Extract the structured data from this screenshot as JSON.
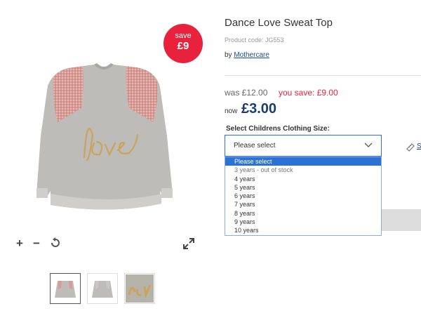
{
  "product": {
    "title": "Dance Love Sweat Top",
    "code": "Product code: JG553",
    "by_prefix": "by",
    "brand": "Mothercare"
  },
  "badge": {
    "line1": "save",
    "line2": "£9"
  },
  "prices": {
    "was": "was £12.00",
    "you_save": "you save: £9.00",
    "now_label": "now",
    "now_price": "£3.00"
  },
  "size": {
    "label": "Select Childrens Clothing Size:",
    "selected": "Please select",
    "options": [
      {
        "label": "Please select",
        "state": "selected"
      },
      {
        "label": "3 years - out of stock",
        "state": "disabled"
      },
      {
        "label": "4 years",
        "state": "normal"
      },
      {
        "label": "5 years",
        "state": "normal"
      },
      {
        "label": "6 years",
        "state": "normal"
      },
      {
        "label": "7 years",
        "state": "normal"
      },
      {
        "label": "8 years",
        "state": "normal"
      },
      {
        "label": "9 years",
        "state": "normal"
      },
      {
        "label": "10 years",
        "state": "normal"
      }
    ]
  },
  "size_guide": {
    "text": "S"
  },
  "image_tools": {
    "zoom_in": "+",
    "zoom_out": "−",
    "icons": [
      "zoom-in-icon",
      "zoom-out-icon",
      "reset-icon",
      "expand-icon"
    ]
  },
  "thumbnails": [
    {
      "name": "front",
      "active": true
    },
    {
      "name": "back",
      "active": false
    },
    {
      "name": "detail",
      "active": false
    }
  ],
  "colors": {
    "accent_red": "#e8223d",
    "price_blue": "#1a3d6d",
    "select_blue": "#2c72d2",
    "sweater_grey": "#bdbcb8",
    "sequin_pink": "#d79a93",
    "gold_text": "#c9a45a"
  }
}
